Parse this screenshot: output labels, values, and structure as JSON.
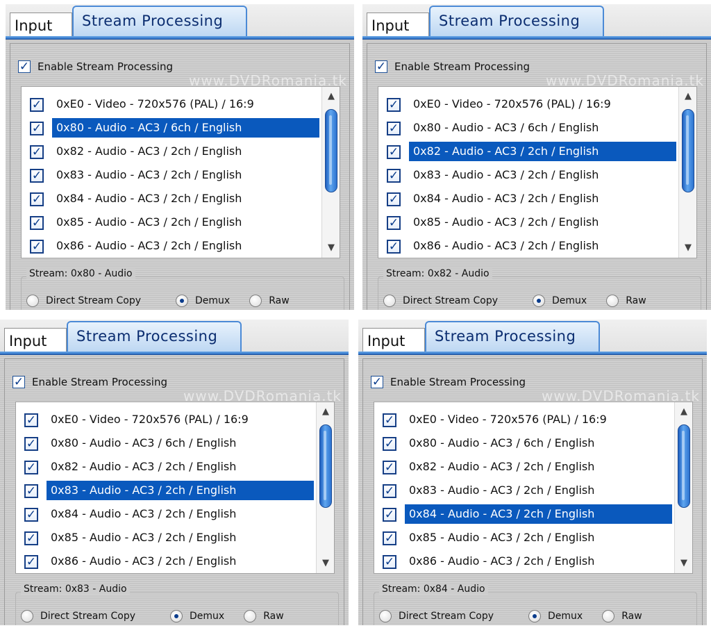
{
  "panels": [
    {
      "tabs": {
        "input": "Input",
        "stream_processing": "Stream Processing"
      },
      "enable_label": "Enable Stream Processing",
      "enable_checked": true,
      "watermark": "www.DVDRomania.tk",
      "streams": [
        {
          "label": "0xE0 - Video - 720x576 (PAL) / 16:9",
          "checked": true,
          "selected": false
        },
        {
          "label": "0x80 - Audio - AC3 / 6ch / English",
          "checked": true,
          "selected": true
        },
        {
          "label": "0x82 - Audio - AC3 / 2ch / English",
          "checked": true,
          "selected": false
        },
        {
          "label": "0x83 - Audio - AC3 / 2ch / English",
          "checked": true,
          "selected": false
        },
        {
          "label": "0x84 - Audio - AC3 / 2ch / English",
          "checked": true,
          "selected": false
        },
        {
          "label": "0x85 - Audio - AC3 / 2ch / English",
          "checked": true,
          "selected": false
        },
        {
          "label": "0x86 - Audio - AC3 / 2ch / English",
          "checked": true,
          "selected": false
        }
      ],
      "stream_group_label": "Stream: 0x80 - Audio",
      "radio": {
        "direct_copy": "Direct Stream Copy",
        "demux": "Demux",
        "raw": "Raw",
        "selected": "demux"
      }
    },
    {
      "tabs": {
        "input": "Input",
        "stream_processing": "Stream Processing"
      },
      "enable_label": "Enable Stream Processing",
      "enable_checked": true,
      "watermark": "www.DVDRomania.tk",
      "streams": [
        {
          "label": "0xE0 - Video - 720x576 (PAL) / 16:9",
          "checked": true,
          "selected": false
        },
        {
          "label": "0x80 - Audio - AC3 / 6ch / English",
          "checked": true,
          "selected": false
        },
        {
          "label": "0x82 - Audio - AC3 / 2ch / English",
          "checked": true,
          "selected": true
        },
        {
          "label": "0x83 - Audio - AC3 / 2ch / English",
          "checked": true,
          "selected": false
        },
        {
          "label": "0x84 - Audio - AC3 / 2ch / English",
          "checked": true,
          "selected": false
        },
        {
          "label": "0x85 - Audio - AC3 / 2ch / English",
          "checked": true,
          "selected": false
        },
        {
          "label": "0x86 - Audio - AC3 / 2ch / English",
          "checked": true,
          "selected": false
        }
      ],
      "stream_group_label": "Stream: 0x82 - Audio",
      "radio": {
        "direct_copy": "Direct Stream Copy",
        "demux": "Demux",
        "raw": "Raw",
        "selected": "demux"
      }
    },
    {
      "tabs": {
        "input": "Input",
        "stream_processing": "Stream Processing"
      },
      "enable_label": "Enable Stream Processing",
      "enable_checked": true,
      "watermark": "www.DVDRomania.tk",
      "streams": [
        {
          "label": "0xE0 - Video - 720x576 (PAL) / 16:9",
          "checked": true,
          "selected": false
        },
        {
          "label": "0x80 - Audio - AC3 / 6ch / English",
          "checked": true,
          "selected": false
        },
        {
          "label": "0x82 - Audio - AC3 / 2ch / English",
          "checked": true,
          "selected": false
        },
        {
          "label": "0x83 - Audio - AC3 / 2ch / English",
          "checked": true,
          "selected": true
        },
        {
          "label": "0x84 - Audio - AC3 / 2ch / English",
          "checked": true,
          "selected": false
        },
        {
          "label": "0x85 - Audio - AC3 / 2ch / English",
          "checked": true,
          "selected": false
        },
        {
          "label": "0x86 - Audio - AC3 / 2ch / English",
          "checked": true,
          "selected": false
        }
      ],
      "stream_group_label": "Stream: 0x83 - Audio",
      "radio": {
        "direct_copy": "Direct Stream Copy",
        "demux": "Demux",
        "raw": "Raw",
        "selected": "demux"
      }
    },
    {
      "tabs": {
        "input": "Input",
        "stream_processing": "Stream Processing"
      },
      "enable_label": "Enable Stream Processing",
      "enable_checked": true,
      "watermark": "www.DVDRomania.tk",
      "streams": [
        {
          "label": "0xE0 - Video - 720x576 (PAL) / 16:9",
          "checked": true,
          "selected": false
        },
        {
          "label": "0x80 - Audio - AC3 / 6ch / English",
          "checked": true,
          "selected": false
        },
        {
          "label": "0x82 - Audio - AC3 / 2ch / English",
          "checked": true,
          "selected": false
        },
        {
          "label": "0x83 - Audio - AC3 / 2ch / English",
          "checked": true,
          "selected": false
        },
        {
          "label": "0x84 - Audio - AC3 / 2ch / English",
          "checked": true,
          "selected": true
        },
        {
          "label": "0x85 - Audio - AC3 / 2ch / English",
          "checked": true,
          "selected": false
        },
        {
          "label": "0x86 - Audio - AC3 / 2ch / English",
          "checked": true,
          "selected": false
        }
      ],
      "stream_group_label": "Stream: 0x84 - Audio",
      "radio": {
        "direct_copy": "Direct Stream Copy",
        "demux": "Demux",
        "raw": "Raw",
        "selected": "demux"
      }
    }
  ],
  "icons": {
    "check": "check-icon",
    "arrow_up": "scroll-up-arrow-icon",
    "arrow_down": "scroll-down-arrow-icon"
  },
  "colors": {
    "selection": "#0a59bd",
    "tab_accent": "#2c6fc4"
  }
}
